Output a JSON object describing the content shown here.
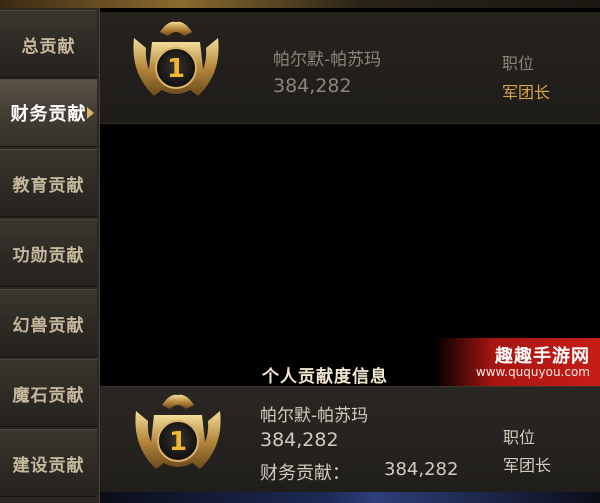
{
  "tabs": [
    {
      "label": "总贡献"
    },
    {
      "label": "财务贡献"
    },
    {
      "label": "教育贡献"
    },
    {
      "label": "功勋贡献"
    },
    {
      "label": "幻兽贡献"
    },
    {
      "label": "魔石贡献"
    },
    {
      "label": "建设贡献"
    }
  ],
  "active_tab": "财务贡献",
  "ranking": {
    "rank": "1",
    "name": "帕尔默-帕苏玛",
    "score": "384,282",
    "position_label": "职位",
    "position_value": "军团长"
  },
  "personal": {
    "title": "个人贡献度信息",
    "rank": "1",
    "name": "帕尔默-帕苏玛",
    "score": "384,282",
    "detail_label": "财务贡献：",
    "detail_value": "384,282",
    "position_label": "职位",
    "position_value": "军团长"
  },
  "watermark": {
    "title": "趣趣手游网",
    "url": "www.ququyou.com"
  },
  "colors": {
    "accent_gold": "#d9a441",
    "active_tab": "#433d34",
    "watermark_red": "#c81d17"
  }
}
